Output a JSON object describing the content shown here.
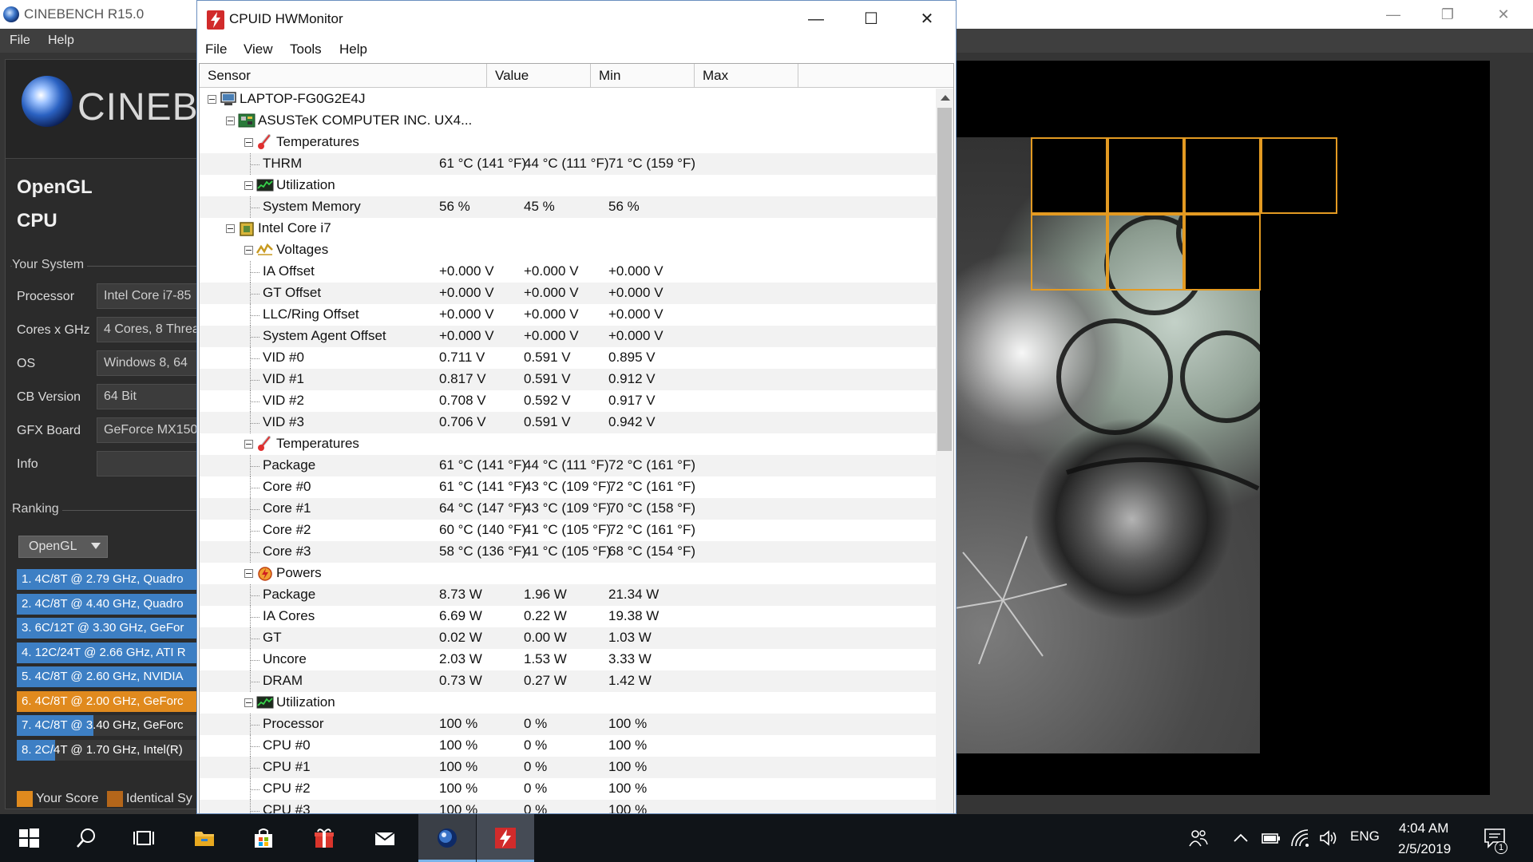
{
  "cinebench": {
    "title": "CINEBENCH R15.0",
    "menu": [
      "File",
      "Help"
    ],
    "logo_text": "CINEBE",
    "tests": [
      "OpenGL",
      "CPU"
    ],
    "your_system": {
      "title": "Your System",
      "rows": [
        {
          "label": "Processor",
          "value": "Intel Core i7-85"
        },
        {
          "label": "Cores x GHz",
          "value": "4 Cores, 8 Threa"
        },
        {
          "label": "OS",
          "value": "Windows 8, 64"
        },
        {
          "label": "CB Version",
          "value": "64 Bit"
        },
        {
          "label": "GFX Board",
          "value": "GeForce MX150"
        },
        {
          "label": "Info",
          "value": ""
        }
      ]
    },
    "ranking": {
      "title": "Ranking",
      "dropdown": "OpenGL",
      "items": [
        {
          "text": "1. 4C/8T @ 2.79 GHz, Quadro",
          "fill": 1.0,
          "color": "#3d7fc4"
        },
        {
          "text": "2. 4C/8T @ 4.40 GHz, Quadro",
          "fill": 1.0,
          "color": "#3d7fc4"
        },
        {
          "text": "3. 6C/12T @ 3.30 GHz, GeFor",
          "fill": 1.0,
          "color": "#3d7fc4"
        },
        {
          "text": "4. 12C/24T @ 2.66 GHz, ATI R",
          "fill": 1.0,
          "color": "#3d7fc4"
        },
        {
          "text": "5. 4C/8T @ 2.60 GHz, NVIDIA",
          "fill": 1.0,
          "color": "#3d7fc4"
        },
        {
          "text": "6. 4C/8T @ 2.00 GHz, GeForc",
          "fill": 1.0,
          "color": "#e08a1e"
        },
        {
          "text": "7. 4C/8T @ 3.40 GHz, GeForc",
          "fill": 0.42,
          "color": "#3d7fc4"
        },
        {
          "text": "8. 2C/4T @ 1.70 GHz, Intel(R)",
          "fill": 0.21,
          "color": "#3d7fc4"
        }
      ]
    },
    "legend": {
      "your_score": "Your Score",
      "identical": "Identical Sy"
    },
    "colors": {
      "your_score": "#e08a1e",
      "identical": "#b4661a",
      "bar": "#3d7fc4"
    }
  },
  "hwmonitor": {
    "title": "CPUID HWMonitor",
    "menu": [
      "File",
      "View",
      "Tools",
      "Help"
    ],
    "columns": [
      "Sensor",
      "Value",
      "Min",
      "Max"
    ],
    "rows": [
      {
        "level": 0,
        "type": "computer-icon",
        "sensor": "LAPTOP-FG0G2E4J",
        "value": "",
        "min": "",
        "max": ""
      },
      {
        "level": 1,
        "type": "motherboard-icon",
        "sensor": "ASUSTeK COMPUTER INC. UX4...",
        "value": "",
        "min": "",
        "max": ""
      },
      {
        "level": 2,
        "type": "thermometer-icon",
        "sensor": "Temperatures",
        "value": "",
        "min": "",
        "max": ""
      },
      {
        "level": 3,
        "type": "",
        "sensor": "THRM",
        "value": "61 °C  (141 °F)",
        "min": "44 °C  (111 °F)",
        "max": "71 °C  (159 °F)"
      },
      {
        "level": 2,
        "type": "utilization-icon",
        "sensor": "Utilization",
        "value": "",
        "min": "",
        "max": ""
      },
      {
        "level": 3,
        "type": "",
        "sensor": "System Memory",
        "value": "56 %",
        "min": "45 %",
        "max": "56 %"
      },
      {
        "level": 1,
        "type": "cpu-chip-icon",
        "sensor": "Intel Core i7",
        "value": "",
        "min": "",
        "max": ""
      },
      {
        "level": 2,
        "type": "voltage-icon",
        "sensor": "Voltages",
        "value": "",
        "min": "",
        "max": ""
      },
      {
        "level": 3,
        "type": "",
        "sensor": "IA Offset",
        "value": "+0.000 V",
        "min": "+0.000 V",
        "max": "+0.000 V"
      },
      {
        "level": 3,
        "type": "",
        "sensor": "GT Offset",
        "value": "+0.000 V",
        "min": "+0.000 V",
        "max": "+0.000 V"
      },
      {
        "level": 3,
        "type": "",
        "sensor": "LLC/Ring Offset",
        "value": "+0.000 V",
        "min": "+0.000 V",
        "max": "+0.000 V"
      },
      {
        "level": 3,
        "type": "",
        "sensor": "System Agent Offset",
        "value": "+0.000 V",
        "min": "+0.000 V",
        "max": "+0.000 V"
      },
      {
        "level": 3,
        "type": "",
        "sensor": "VID #0",
        "value": "0.711 V",
        "min": "0.591 V",
        "max": "0.895 V"
      },
      {
        "level": 3,
        "type": "",
        "sensor": "VID #1",
        "value": "0.817 V",
        "min": "0.591 V",
        "max": "0.912 V"
      },
      {
        "level": 3,
        "type": "",
        "sensor": "VID #2",
        "value": "0.708 V",
        "min": "0.592 V",
        "max": "0.917 V"
      },
      {
        "level": 3,
        "type": "",
        "sensor": "VID #3",
        "value": "0.706 V",
        "min": "0.591 V",
        "max": "0.942 V"
      },
      {
        "level": 2,
        "type": "thermometer-icon",
        "sensor": "Temperatures",
        "value": "",
        "min": "",
        "max": ""
      },
      {
        "level": 3,
        "type": "",
        "sensor": "Package",
        "value": "61 °C  (141 °F)",
        "min": "44 °C  (111 °F)",
        "max": "72 °C  (161 °F)"
      },
      {
        "level": 3,
        "type": "",
        "sensor": "Core #0",
        "value": "61 °C  (141 °F)",
        "min": "43 °C  (109 °F)",
        "max": "72 °C  (161 °F)"
      },
      {
        "level": 3,
        "type": "",
        "sensor": "Core #1",
        "value": "64 °C  (147 °F)",
        "min": "43 °C  (109 °F)",
        "max": "70 °C  (158 °F)"
      },
      {
        "level": 3,
        "type": "",
        "sensor": "Core #2",
        "value": "60 °C  (140 °F)",
        "min": "41 °C  (105 °F)",
        "max": "72 °C  (161 °F)"
      },
      {
        "level": 3,
        "type": "",
        "sensor": "Core #3",
        "value": "58 °C  (136 °F)",
        "min": "41 °C  (105 °F)",
        "max": "68 °C  (154 °F)"
      },
      {
        "level": 2,
        "type": "power-icon",
        "sensor": "Powers",
        "value": "",
        "min": "",
        "max": ""
      },
      {
        "level": 3,
        "type": "",
        "sensor": "Package",
        "value": "8.73 W",
        "min": "1.96 W",
        "max": "21.34 W"
      },
      {
        "level": 3,
        "type": "",
        "sensor": "IA Cores",
        "value": "6.69 W",
        "min": "0.22 W",
        "max": "19.38 W"
      },
      {
        "level": 3,
        "type": "",
        "sensor": "GT",
        "value": "0.02 W",
        "min": "0.00 W",
        "max": "1.03 W"
      },
      {
        "level": 3,
        "type": "",
        "sensor": "Uncore",
        "value": "2.03 W",
        "min": "1.53 W",
        "max": "3.33 W"
      },
      {
        "level": 3,
        "type": "",
        "sensor": "DRAM",
        "value": "0.73 W",
        "min": "0.27 W",
        "max": "1.42 W"
      },
      {
        "level": 2,
        "type": "utilization-icon",
        "sensor": "Utilization",
        "value": "",
        "min": "",
        "max": ""
      },
      {
        "level": 3,
        "type": "",
        "sensor": "Processor",
        "value": "100 %",
        "min": "0 %",
        "max": "100 %"
      },
      {
        "level": 3,
        "type": "",
        "sensor": "CPU #0",
        "value": "100 %",
        "min": "0 %",
        "max": "100 %"
      },
      {
        "level": 3,
        "type": "",
        "sensor": "CPU #1",
        "value": "100 %",
        "min": "0 %",
        "max": "100 %"
      },
      {
        "level": 3,
        "type": "",
        "sensor": "CPU #2",
        "value": "100 %",
        "min": "0 %",
        "max": "100 %"
      },
      {
        "level": 3,
        "type": "",
        "sensor": "CPU #3",
        "value": "100 %",
        "min": "0 %",
        "max": "100 %"
      }
    ]
  },
  "taskbar": {
    "apps": [
      "start-icon",
      "search-icon",
      "task-view-icon",
      "file-explorer-icon",
      "store-icon",
      "gift-app-icon",
      "mail-icon",
      "cinebench-icon",
      "hwmonitor-icon"
    ],
    "language": "ENG",
    "time": "4:04 AM",
    "date": "2/5/2019",
    "notification_count": "1"
  }
}
